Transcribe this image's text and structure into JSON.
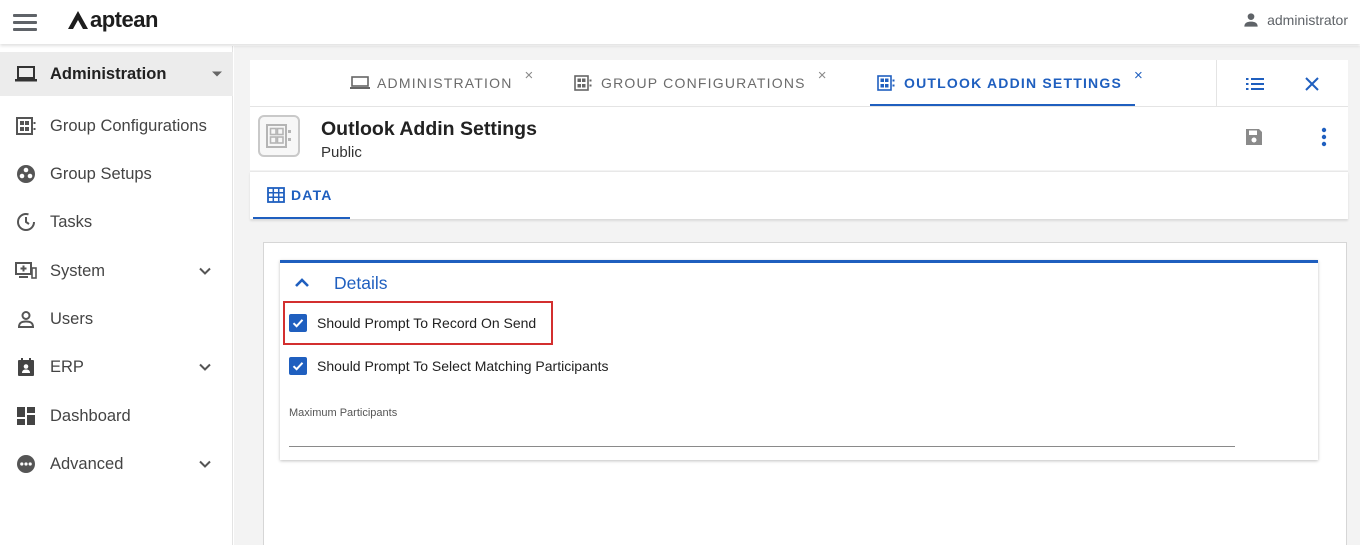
{
  "app": {
    "brand": "aptean",
    "user": "administrator"
  },
  "sidebar": {
    "items": [
      {
        "label": "Administration",
        "icon": "laptop-icon"
      },
      {
        "label": "Group Configurations",
        "icon": "group-config-icon"
      },
      {
        "label": "Group Setups",
        "icon": "group-setups-icon"
      },
      {
        "label": "Tasks",
        "icon": "tasks-timer-icon"
      },
      {
        "label": "System",
        "icon": "system-icon"
      },
      {
        "label": "Users",
        "icon": "user-icon"
      },
      {
        "label": "ERP",
        "icon": "erp-icon"
      },
      {
        "label": "Dashboard",
        "icon": "dashboard-icon"
      },
      {
        "label": "Advanced",
        "icon": "advanced-icon"
      }
    ]
  },
  "tabs": [
    {
      "label": "ADMINISTRATION",
      "close": "×"
    },
    {
      "label": "GROUP CONFIGURATIONS",
      "close": "×"
    },
    {
      "label": "OUTLOOK ADDIN SETTINGS",
      "close": "×"
    }
  ],
  "header": {
    "title": "Outlook Addin Settings",
    "subtitle": "Public"
  },
  "subtabs": [
    {
      "label": "DATA"
    }
  ],
  "details": {
    "title": "Details",
    "checkboxes": [
      {
        "label": "Should Prompt To Record On Send",
        "checked": true
      },
      {
        "label": "Should Prompt To Select Matching Participants",
        "checked": true
      }
    ],
    "max_participants_label": "Maximum Participants",
    "max_participants_value": ""
  },
  "colors": {
    "accent": "#1f5fbf",
    "highlight": "#d32f2f"
  }
}
